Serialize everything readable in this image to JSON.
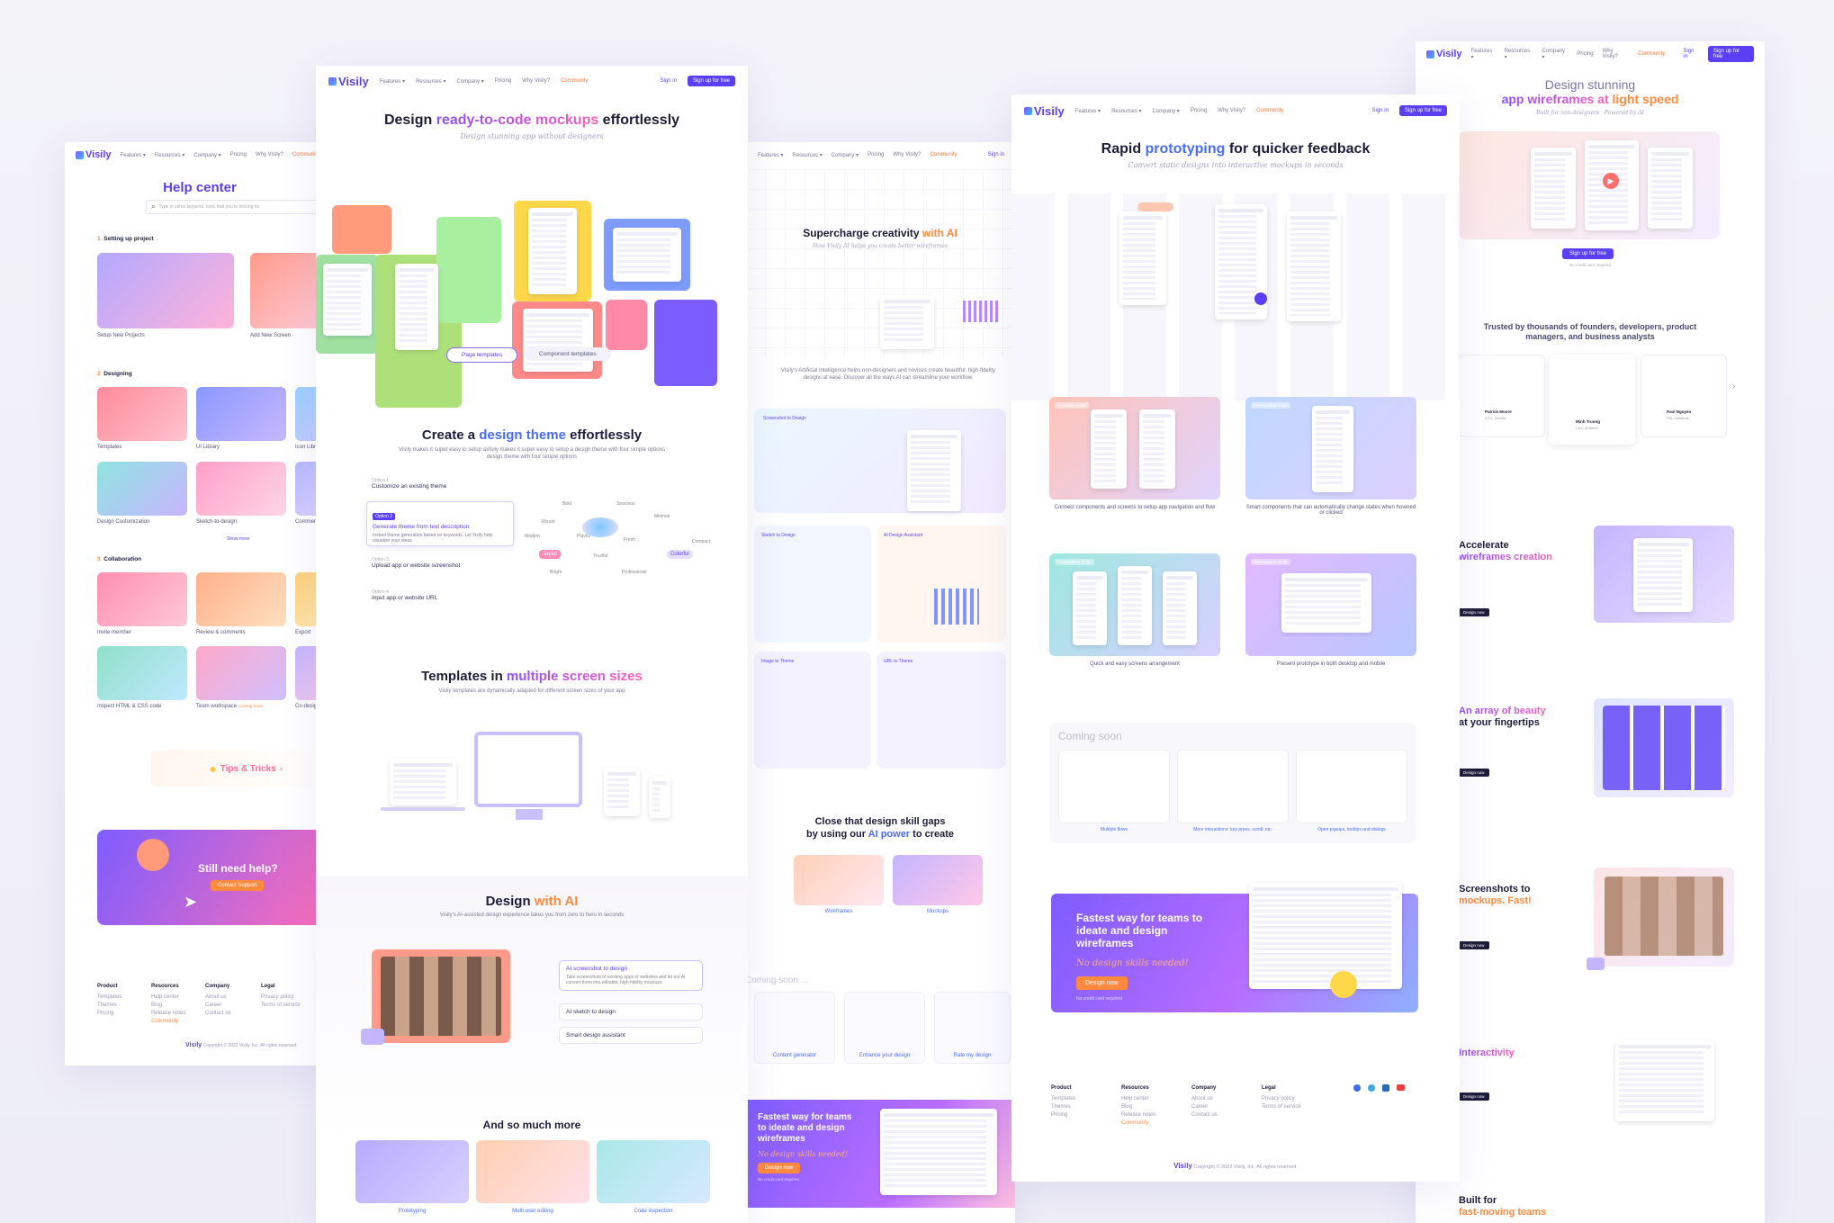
{
  "brand": {
    "logo_text": "Visily"
  },
  "nav": {
    "features": "Features ▾",
    "resources": "Resources ▾",
    "company": "Company ▾",
    "pricing": "Pricing",
    "why": "Why Visily?",
    "community": "Community",
    "signin": "Sign in",
    "signup": "Sign up for free"
  },
  "help_page": {
    "title": "Help center",
    "search_placeholder": "Type in some keyword, topic that you're looking for",
    "sections": [
      {
        "label": "Setting up project",
        "items": [
          "Setup New Projects",
          "Add New Screen"
        ]
      },
      {
        "label": "Designing",
        "items": [
          "Templates",
          "UI Library",
          "Icon Library",
          "Design Customization",
          "Sketch-to-design",
          "Comment"
        ]
      },
      {
        "label": "Collaboration",
        "items": [
          "Invite member",
          "Review & comments",
          "Export",
          "Inspect HTML & CSS code",
          "Team workspace",
          "Co-design"
        ]
      }
    ],
    "show_more": "Show more",
    "coming_soon": "Coming Soon",
    "tips": "Tips & Tricks",
    "still_help": "Still need help?",
    "contact": "Contact Support",
    "copyright": "Copyright © 2022 Visily, Inc. All rights reserved.",
    "footer": {
      "product": {
        "title": "Product",
        "items": [
          "Templates",
          "Themes",
          "Pricing"
        ]
      },
      "resources": {
        "title": "Resources",
        "items": [
          "Help center",
          "Blog",
          "Release notes",
          "Community"
        ]
      },
      "company": {
        "title": "Company",
        "items": [
          "About us",
          "Career",
          "Contact us"
        ]
      },
      "legal": {
        "title": "Legal",
        "items": [
          "Privacy policy",
          "Terms of service"
        ]
      }
    }
  },
  "main_page": {
    "hero_pre": "Design ",
    "hero_hl": "ready-to-code mockups",
    "hero_post": " effortlessly",
    "hero_sub": "Design stunning app without designers",
    "tab_page": "Page templates",
    "tab_component": "Component templates",
    "theme_pre": "Create a ",
    "theme_hl": "design theme",
    "theme_post": " effortlessly",
    "theme_sub": "Visily makes it super easy to setup aVisily makes it super easy to setup a design theme with four simple options design theme with four simple options",
    "options": [
      {
        "tag": "Option 1",
        "label": "Customize an existing theme"
      },
      {
        "tag": "Option 2",
        "label": "Generate theme from text description",
        "desc": "Instant theme generation based on keywords. Let Visily help visualize your ideas."
      },
      {
        "tag": "Option 3",
        "label": "Upload app or website screenshot"
      },
      {
        "tag": "Option 4",
        "label": "Input app or website URL"
      }
    ],
    "keywords": [
      "Bold",
      "Spacious",
      "Minimal",
      "Vibrant",
      "Modern",
      "Playful",
      "Fresh",
      "Compact",
      "Joyful",
      "Colorful",
      "Trustful",
      "Bright",
      "Professional"
    ],
    "templates_pre": "Templates in ",
    "templates_hl": "multiple screen sizes",
    "templates_sub": "Visily templates are dynamically adapted for different screen sizes of your app",
    "ai_pre": "Design ",
    "ai_hl": "with AI",
    "ai_sub": "Visily's AI-assisted design experience takes you from zero to hero in seconds",
    "ai_options": [
      {
        "label": "AI screenshot to design",
        "desc": "Take screenshots of existing apps or websites and let our AI convert them into editable, high-fidelity mockups"
      },
      {
        "label": "AI sketch to design"
      },
      {
        "label": "Smart design assistant"
      }
    ],
    "more": "And so much more",
    "more_items": [
      "Prototyping",
      "Multi-user editing",
      "Code inspection"
    ]
  },
  "ai_page": {
    "title_pre": "Supercharge creativity ",
    "title_hl": "with AI",
    "sub": "How Visily AI helps you create better wireframes",
    "desc": "Visily's Artificial Intelligence helps non-designers and novices create beautiful, high-fidelity designs at ease. Discover all the ways AI can streamline your workflow.",
    "features": [
      "Screenshot to Design",
      "Sketch to Design",
      "AI Design Assistant",
      "Image to Theme",
      "URL to Theme"
    ],
    "close_pre": "Close that design skill gaps",
    "close_mid": "by using our ",
    "close_hl": "AI power",
    "close_post": " to create",
    "close_items": [
      "Wireframes",
      "Mockups"
    ],
    "coming": "Coming soon ...",
    "coming_items": [
      "Content generator",
      "Enhance your design",
      "Rate my design"
    ],
    "cta_title": "Fastest way for teams to ideate and design wireframes",
    "cta_sub": "No design skills needed!",
    "cta_btn": "Design now",
    "cta_note": "No credit card required"
  },
  "proto_page": {
    "title_pre": "Rapid ",
    "title_hl": "prototyping",
    "title_post": " for quicker feedback",
    "sub": "Convert static designs into interactive mockups in seconds",
    "features": [
      {
        "tag": "Prototype mode",
        "caption": "Connect components and screens to setup app navigation and flow"
      },
      {
        "tag": "Presentation mode",
        "caption": "Smart components that can automatically change states when hovered or clicked"
      },
      {
        "tag": "Presentation mode",
        "caption": "Quick and easy screens arrangement"
      },
      {
        "tag": "Presentation mode",
        "caption": "Present prototype in both desktop and mobile"
      }
    ],
    "coming": "Coming soon",
    "coming_items": [
      "Multiple flows",
      "More interactions: key press, scroll, etc.",
      "Open popups, tooltips and dialogs"
    ],
    "cta_title": "Fastest way for teams to ideate and design wireframes",
    "cta_sub": "No design skills needed!",
    "cta_btn": "Design now",
    "cta_note": "No credit card required",
    "copyright": "Copyright © 2022 Visily, Inc. All rights reserved.",
    "footer": {
      "product": {
        "title": "Product",
        "items": [
          "Templates",
          "Themes",
          "Pricing"
        ]
      },
      "resources": {
        "title": "Resources",
        "items": [
          "Help center",
          "Blog",
          "Release notes",
          "Community"
        ]
      },
      "company": {
        "title": "Company",
        "items": [
          "About us",
          "Career",
          "Contact us"
        ]
      },
      "legal": {
        "title": "Legal",
        "items": [
          "Privacy policy",
          "Terms of service"
        ]
      }
    }
  },
  "landing_page": {
    "title1": "Design stunning",
    "title2_pre": "app wireframes at ",
    "title2_hl": "light speed",
    "sub": "Built for non-designers · Powered by AI",
    "cta": "Sign up for free",
    "note": "No credit card required",
    "trusted": "Trusted by thousands of founders, developers, product managers, and business analysts",
    "testimonials": [
      {
        "name": "Patrick Moore",
        "role": "CTO, Xendia"
      },
      {
        "name": "Minh Truong",
        "role": "CEO of Nexel"
      },
      {
        "name": "Paul Nguyen",
        "role": "PM, Solutions"
      }
    ],
    "features": [
      {
        "pre": "Accelerate ",
        "hl": "wireframes creation"
      },
      {
        "pre": "An array of beauty ",
        "hl": "at your fingertips"
      },
      {
        "pre": "Screenshots to ",
        "hl": "mockups. Fast!"
      },
      {
        "pre": "Interactivity",
        "hl": ""
      }
    ],
    "learn": "Design now",
    "built1": "Built for",
    "built2": "fast-moving teams"
  },
  "colors": {
    "primary": "#5b3ff5",
    "accent_orange": "#ff8a3d",
    "accent_pink": "#ff5fb8",
    "accent_blue": "#4a6cff"
  },
  "icons": [
    "visily-logo-icon",
    "search-icon",
    "chevron-right-icon",
    "play-icon",
    "facebook-icon",
    "twitter-icon",
    "linkedin-icon",
    "youtube-icon",
    "camera-icon",
    "paper-plane-icon",
    "phone-icon"
  ]
}
